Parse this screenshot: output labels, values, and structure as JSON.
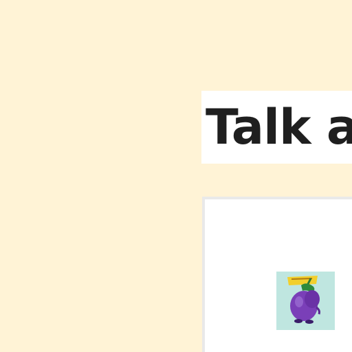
{
  "page": {
    "title": "Talk a",
    "background_color": "#fff3d6"
  },
  "content_panel": {
    "thumbnail": {
      "icon": "eggplant-illustration",
      "caption": "",
      "background_color": "#bfe6e0",
      "subject_color": "#7a3fb8"
    }
  }
}
